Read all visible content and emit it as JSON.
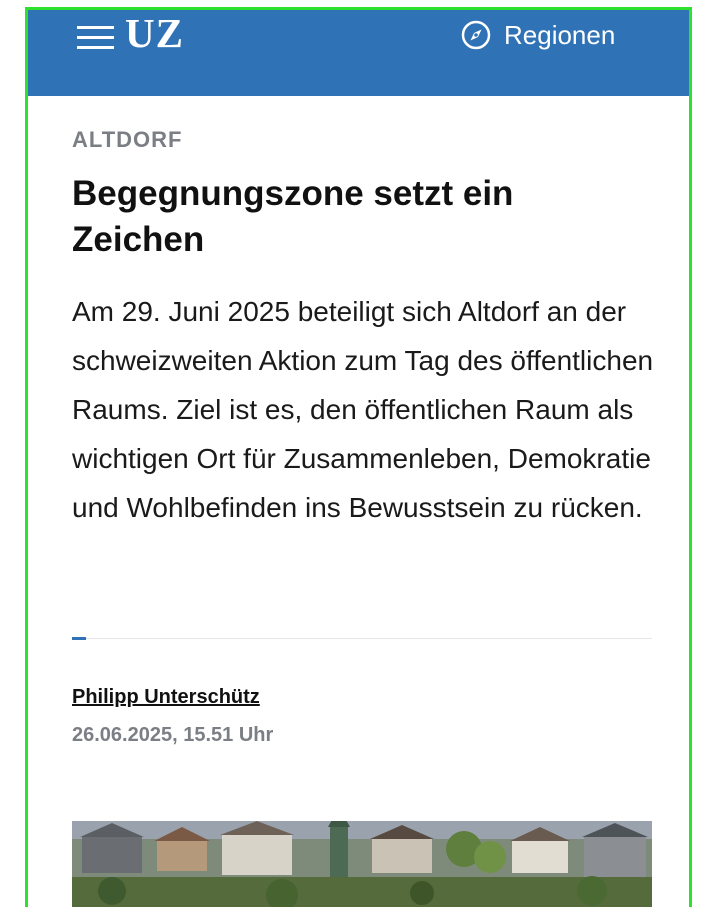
{
  "header": {
    "logo": "UZ",
    "regions_label": "Regionen",
    "menu_icon": "hamburger-icon",
    "regions_icon": "compass-icon",
    "background_color": "#2f73b6"
  },
  "article": {
    "kicker": "ALTDORF",
    "headline": "Begegnungszone setzt ein Zeichen",
    "lead": "Am 29. Juni 2025 beteiligt sich Altdorf an der schweizweiten Aktion zum Tag des öffentlichen Raums. Ziel ist es, den öffentlichen Raum als wichtigen Ort für Zusammenleben, Demokratie und Wohlbefinden ins Bewusstsein zu rücken.",
    "author": "Philipp Unterschütz",
    "date": "26.06.2025, 15.51 Uhr"
  },
  "colors": {
    "accent": "#2f73b6",
    "meta_gray": "#7b7e84",
    "frame_green": "#2fe12f"
  }
}
